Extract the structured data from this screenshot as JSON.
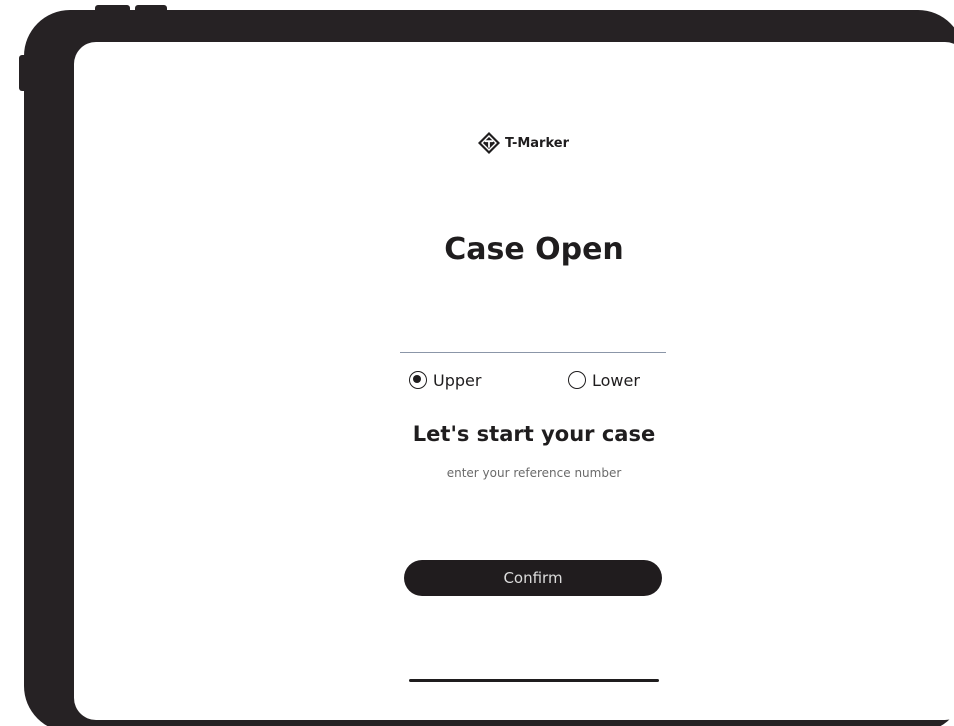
{
  "app": {
    "brand_name": "T-Marker",
    "brand_icon": "t-marker-logo"
  },
  "page": {
    "title": "Case Open"
  },
  "jaw_selector": {
    "options": [
      {
        "label": "Upper",
        "selected": true
      },
      {
        "label": "Lower",
        "selected": false
      }
    ]
  },
  "form": {
    "heading": "Let's start your case",
    "subtext": "enter your reference number",
    "confirm_label": "Confirm"
  },
  "colors": {
    "text_primary": "#1f1d1e",
    "device_frame": "#262224",
    "button_background": "#201c1e",
    "divider": "#8b96a8"
  }
}
